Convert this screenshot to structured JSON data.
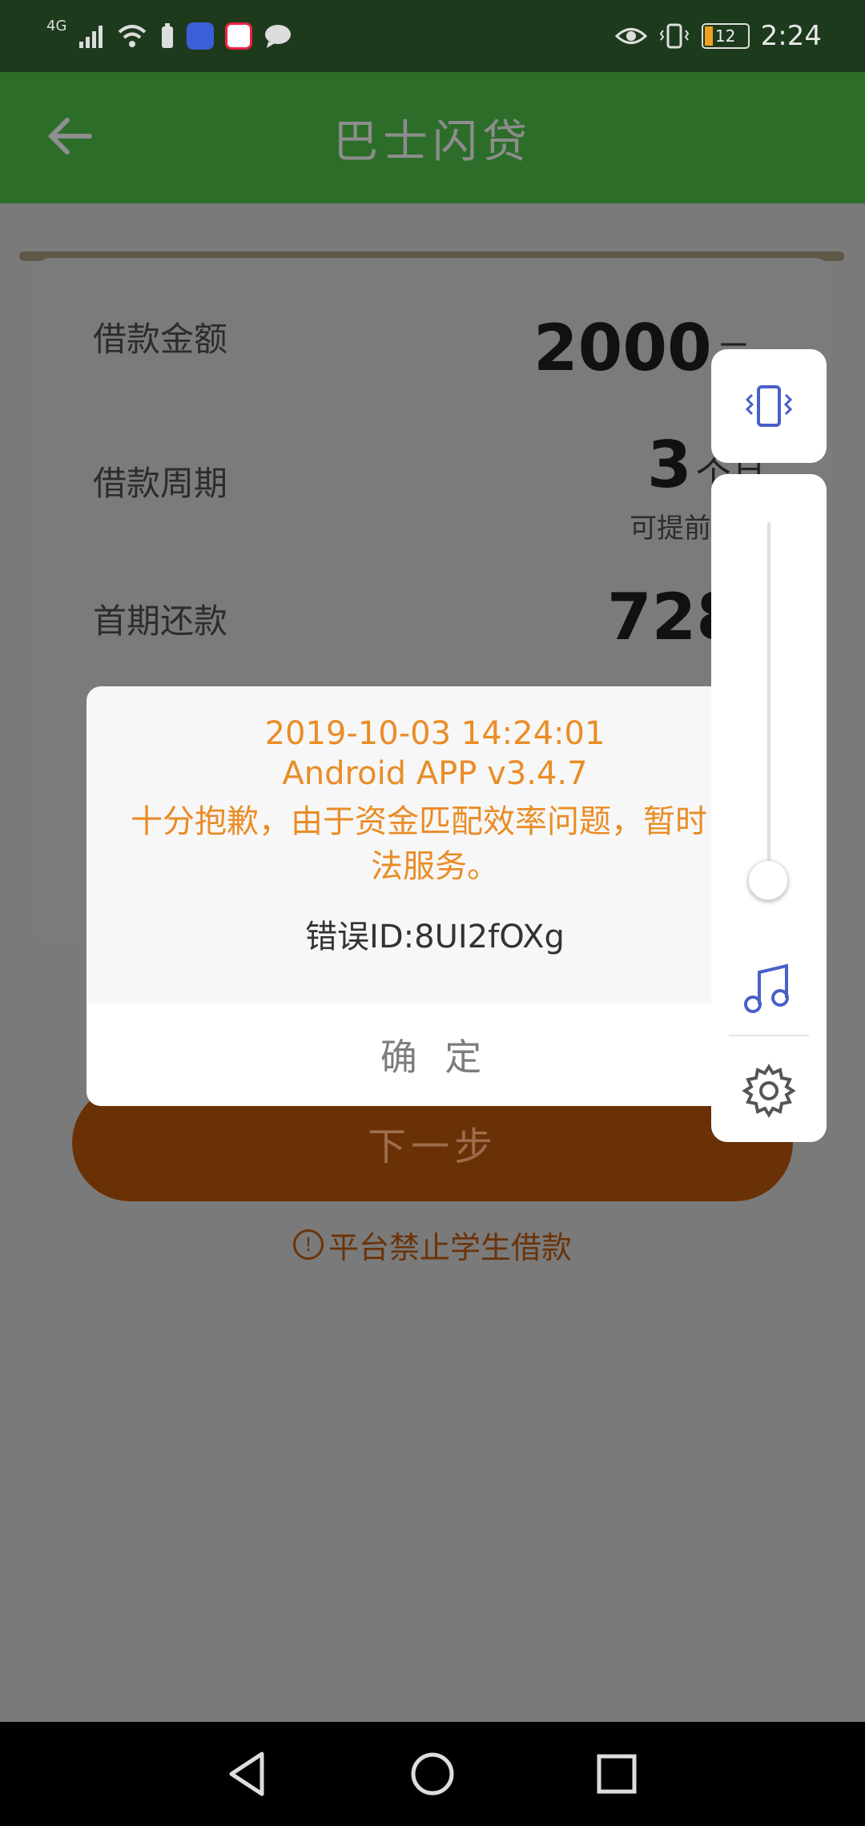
{
  "status_bar": {
    "network": "4G",
    "battery": "12",
    "time": "2:24"
  },
  "app_bar": {
    "title": "巴士闪贷"
  },
  "loan": {
    "amount_label": "借款金额",
    "amount_value": "2000",
    "amount_unit": "元",
    "period_label": "借款周期",
    "period_value": "3",
    "period_unit": "个月",
    "period_note": "可提前",
    "first_payment_label": "首期还款",
    "first_payment_value": "728"
  },
  "next_button": "下一步",
  "notice": {
    "icon": "!",
    "text": "平台禁止学生借款"
  },
  "dialog": {
    "timestamp": "2019-10-03 14:24:01",
    "app_version": "Android APP v3.4.7",
    "message_line1": "十分抱歉，由于资金匹配效率问题，暂时",
    "message_line2": "法服务。",
    "error_id": "错误ID:8UI2fOXg",
    "ok_button": "确 定"
  },
  "volume_panel": {
    "level": 0.05,
    "accent_color": "#4a5fc7"
  }
}
